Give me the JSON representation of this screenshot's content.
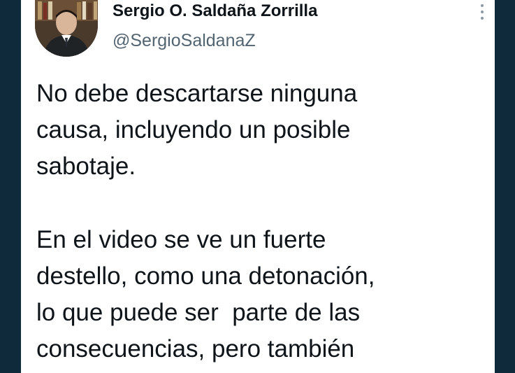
{
  "tweet": {
    "author_name": "Sergio O. Saldaña Zorrilla",
    "author_handle": "@SergioSaldanaZ",
    "avatar_icon": "profile-photo",
    "more_icon": "vertical-ellipsis",
    "paragraph1": "No debe descartarse ninguna\ncausa, incluyendo un posible\nsabotaje.",
    "paragraph2": "En el video se ve un fuerte\ndestello, como una detonación,\nlo que puede ser  parte de las\nconsecuencias, pero también"
  },
  "colors": {
    "background": "#0f2a3b",
    "card": "#ffffff",
    "text": "#0f1419",
    "secondary_text": "#536471"
  }
}
